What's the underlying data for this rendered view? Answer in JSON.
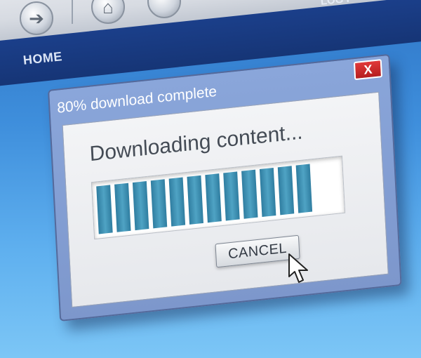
{
  "browser": {
    "nav_arrow_icon": "arrow-right-icon",
    "nav_home_icon": "home-icon",
    "login_label": "LOG I",
    "menu": {
      "home_label": "HOME"
    }
  },
  "dialog": {
    "title": "80% download complete",
    "close_label": "X",
    "status_text": "Downloading content...",
    "progress_percent": 80,
    "cancel_label": "CANCEL"
  },
  "colors": {
    "accent_blue": "#163576",
    "progress_fill": "#3a8fb3",
    "close_red": "#c62828"
  }
}
